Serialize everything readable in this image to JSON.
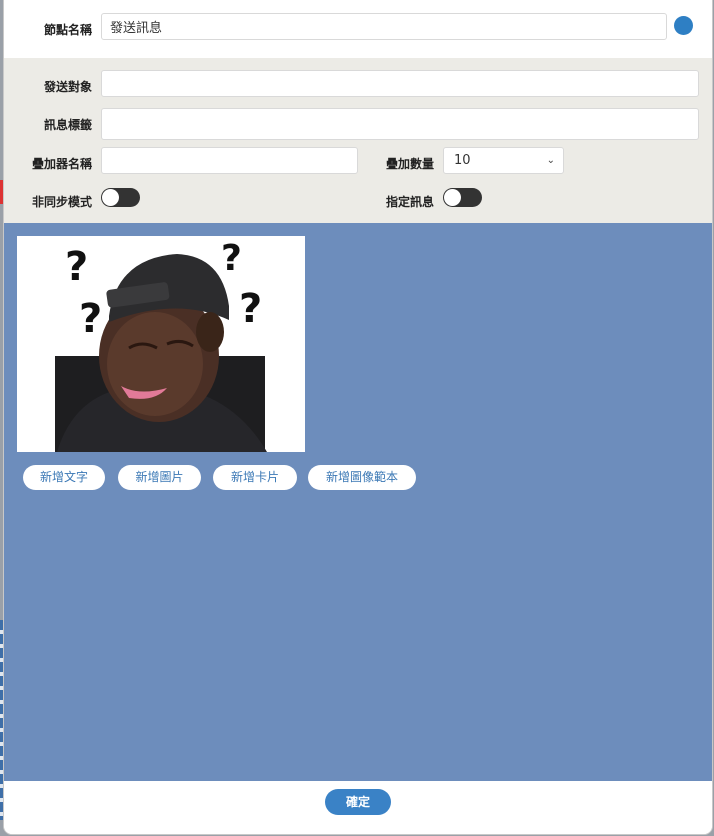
{
  "header": {
    "node_name_label": "節點名稱",
    "node_name_value": "發送訊息"
  },
  "settings": {
    "target_label": "發送對象",
    "target_value": "",
    "tag_label": "訊息標籤",
    "tag_value": "",
    "overlay_name_label": "疊加器名稱",
    "overlay_name_value": "",
    "overlay_count_label": "疊加數量",
    "overlay_count_value": "10",
    "async_label": "非同步模式",
    "async_enabled": false,
    "specify_label": "指定訊息",
    "specify_enabled": false
  },
  "content": {
    "buttons": {
      "add_text": "新增文字",
      "add_image": "新增圖片",
      "add_card": "新增卡片",
      "add_image_template": "新增圖像範本"
    }
  },
  "footer": {
    "confirm_label": "確定"
  },
  "colors": {
    "accent": "#3a82c6",
    "content_bg": "#6d8dbc",
    "settings_bg": "#ecebe6",
    "toggle_off": "#333333"
  }
}
